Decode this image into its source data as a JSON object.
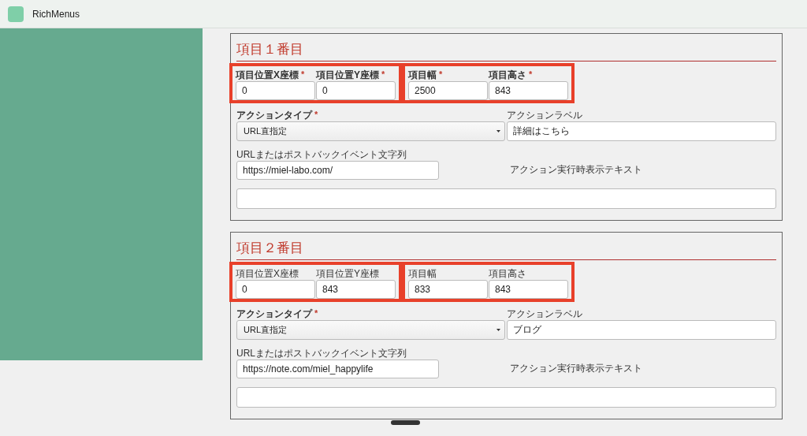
{
  "app": {
    "title": "RichMenus"
  },
  "items": [
    {
      "title": "項目１番目",
      "groups": [
        {
          "highlighted": true,
          "fields": [
            {
              "label": "項目位置X座標",
              "required": true,
              "required_mark": "*",
              "value": "0"
            },
            {
              "label": "項目位置Y座標",
              "required": true,
              "required_mark": "*",
              "value": "0"
            }
          ]
        },
        {
          "highlighted": true,
          "fields": [
            {
              "label": "項目幅",
              "required": true,
              "required_mark": "*",
              "value": "2500"
            },
            {
              "label": "項目高さ",
              "required": true,
              "required_mark": "*",
              "value": "843"
            }
          ]
        }
      ],
      "action_type": {
        "label": "アクションタイプ",
        "required": true,
        "required_mark": "*",
        "value": "URL直指定"
      },
      "action_label": {
        "label": "アクションラベル",
        "required": false,
        "value": "詳細はこちら"
      },
      "url": {
        "label": "URLまたはポストバックイベント文字列",
        "required": false,
        "value": "https://miel-labo.com/"
      },
      "display_text": {
        "label": "アクション実行時表示テキスト",
        "required": false
      }
    },
    {
      "title": "項目２番目",
      "groups": [
        {
          "highlighted": true,
          "fields": [
            {
              "label": "項目位置X座標",
              "required": false,
              "value": "0"
            },
            {
              "label": "項目位置Y座標",
              "required": false,
              "value": "843"
            }
          ]
        },
        {
          "highlighted": true,
          "fields": [
            {
              "label": "項目幅",
              "required": false,
              "value": "833"
            },
            {
              "label": "項目高さ",
              "required": false,
              "value": "843"
            }
          ]
        }
      ],
      "action_type": {
        "label": "アクションタイプ",
        "required": true,
        "required_mark": "*",
        "value": "URL直指定"
      },
      "action_label": {
        "label": "アクションラベル",
        "required": false,
        "value": "ブログ"
      },
      "url": {
        "label": "URLまたはポストバックイベント文字列",
        "required": false,
        "value": "https://note.com/miel_happylife"
      },
      "display_text": {
        "label": "アクション実行時表示テキスト",
        "required": false
      }
    }
  ]
}
